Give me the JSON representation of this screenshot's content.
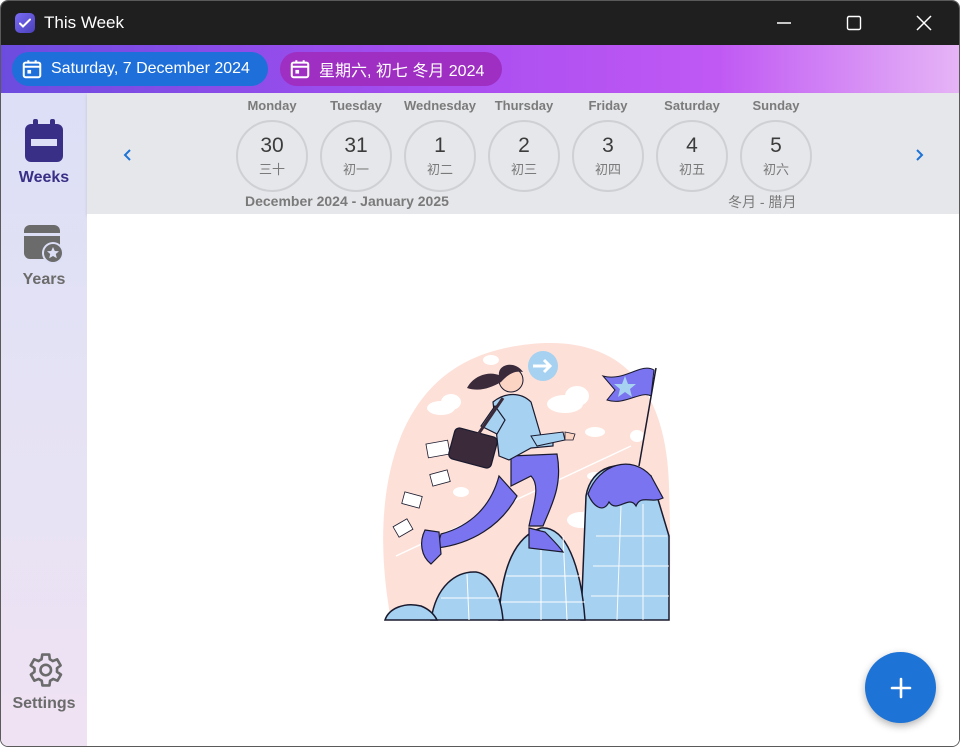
{
  "window": {
    "title": "This Week",
    "icons": {
      "app": "check-calendar-icon",
      "minimize": "minimize-icon",
      "maximize": "maximize-icon",
      "close": "close-icon"
    }
  },
  "header": {
    "gregorian_date": "Saturday, 7 December 2024",
    "lunar_date": "星期六, 初七 冬月 2024",
    "icon": "calendar-icon"
  },
  "sidebar": {
    "items": [
      {
        "label": "Weeks",
        "icon": "calendar-icon",
        "selected": true
      },
      {
        "label": "Years",
        "icon": "calendar-star-icon",
        "selected": false
      },
      {
        "label": "Settings",
        "icon": "gear-icon",
        "selected": false
      }
    ]
  },
  "week": {
    "days": [
      {
        "name": "Monday",
        "day": "30",
        "lunar": "三十"
      },
      {
        "name": "Tuesday",
        "day": "31",
        "lunar": "初一"
      },
      {
        "name": "Wednesday",
        "day": "1",
        "lunar": "初二"
      },
      {
        "name": "Thursday",
        "day": "2",
        "lunar": "初三"
      },
      {
        "name": "Friday",
        "day": "3",
        "lunar": "初四"
      },
      {
        "name": "Saturday",
        "day": "4",
        "lunar": "初五"
      },
      {
        "name": "Sunday",
        "day": "5",
        "lunar": "初六"
      }
    ],
    "month_range": "December 2024 - January 2025",
    "lunar_month_range": "冬月 - 腊月",
    "icons": {
      "prev": "chevron-left-icon",
      "next": "chevron-right-icon"
    }
  },
  "content": {
    "illustration": "mountain-climber-illustration",
    "fab_icon": "plus-icon"
  },
  "colors": {
    "accent": "#1d73d6",
    "selected_nav": "#3a2f86",
    "header_gradient_start": "#6c4ce0",
    "header_gradient_end": "#e6b4f6"
  }
}
